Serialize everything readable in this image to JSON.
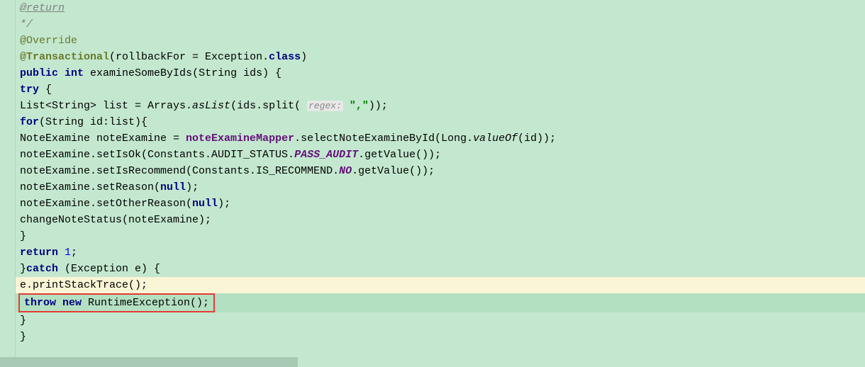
{
  "lines": {
    "l1a": "@return",
    "l1b": "     */",
    "l2": "@Override",
    "l3_ann": "@Transactional",
    "l3_rest": "(rollbackFor = Exception.",
    "l3_class": "class",
    "l3_end": ")",
    "l4_public": "public ",
    "l4_int": "int ",
    "l4_method": "examineSomeByIds",
    "l4_params": "(String ids) {",
    "l5_try": "try",
    "l5_brace": " {",
    "l6_a": "List<String> list = Arrays.",
    "l6_aslist": "asList",
    "l6_b": "(ids.split( ",
    "l6_hint": "regex:",
    "l6_str": " \",\"",
    "l6_end": "));",
    "l7_for": "for",
    "l7_rest": "(String id:list){",
    "l8_a": "NoteExamine noteExamine = ",
    "l8_field": "noteExamineMapper",
    "l8_b": ".selectNoteExamineById(Long.",
    "l8_valueof": "valueOf",
    "l8_c": "(id));",
    "l9_a": "noteExamine.setIsOk(Constants.AUDIT_STATUS.",
    "l9_field": "PASS_AUDIT",
    "l9_b": ".getValue());",
    "l10_a": "noteExamine.setIsRecommend(Constants.IS_RECOMMEND.",
    "l10_field": "NO",
    "l10_b": ".getValue());",
    "l11_a": "noteExamine.setReason(",
    "l11_null": "null",
    "l11_b": ");",
    "l12_a": "noteExamine.setOtherReason(",
    "l12_null": "null",
    "l12_b": ");",
    "l13": "changeNoteStatus(noteExamine);",
    "l14": "}",
    "l15_ret": "return ",
    "l15_num": "1",
    "l15_end": ";",
    "l16_a": "}",
    "l16_catch": "catch",
    "l16_b": " (Exception e) {",
    "l17": "e.printStackTrace();",
    "l18_throw": "throw ",
    "l18_new": "new ",
    "l18_rest": "RuntimeException();",
    "l19": "}",
    "l21": "}"
  },
  "indent": {
    "i1": "    ",
    "i2": "        ",
    "i3": "            ",
    "i4": "                "
  }
}
